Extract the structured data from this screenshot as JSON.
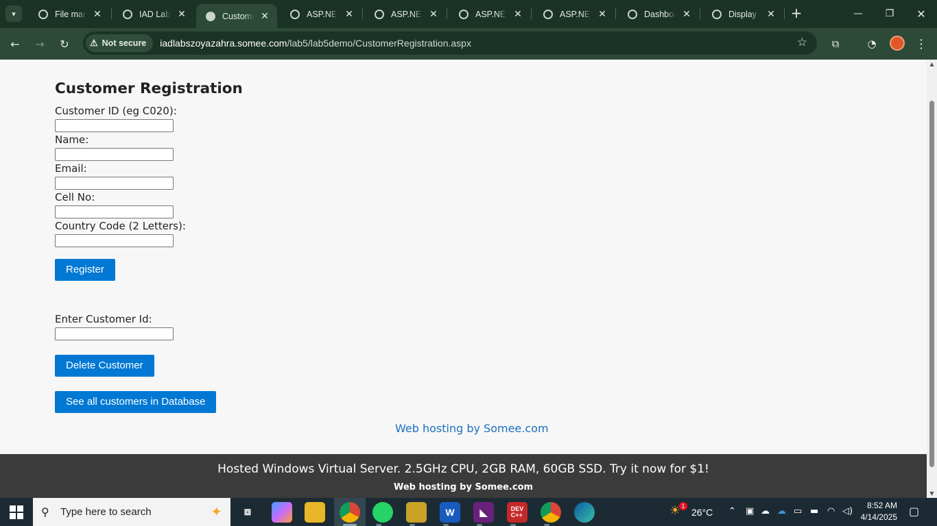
{
  "browser": {
    "tabs": [
      {
        "title": "File manager",
        "active": false
      },
      {
        "title": "IAD Lab Portal",
        "active": false
      },
      {
        "title": "Customer Registration",
        "active": true
      },
      {
        "title": "ASP.NET Page",
        "active": false
      },
      {
        "title": "ASP.NET Page",
        "active": false
      },
      {
        "title": "ASP.NET Page",
        "active": false
      },
      {
        "title": "ASP.NET Page",
        "active": false
      },
      {
        "title": "Dashboard",
        "active": false
      },
      {
        "title": "Display HTML",
        "active": false
      }
    ],
    "security_label": "Not secure",
    "url_host": "iadlabszoyazahra.somee.com",
    "url_path": "/lab5/lab5demo/CustomerRegistration.aspx"
  },
  "page": {
    "title": "Customer Registration",
    "fields": [
      {
        "label": "Customer ID (eg C020):",
        "value": ""
      },
      {
        "label": "Name:",
        "value": ""
      },
      {
        "label": "Email:",
        "value": ""
      },
      {
        "label": "Cell No:",
        "value": ""
      },
      {
        "label": "Country Code (2 Letters):",
        "value": ""
      }
    ],
    "register_label": "Register",
    "delete_field_label": "Enter Customer Id:",
    "delete_label": "Delete Customer",
    "see_all_label": "See all customers in Database",
    "hosting_link": "Web hosting by Somee.com",
    "ad_main": "Hosted Windows Virtual Server. 2.5GHz CPU, 2GB RAM, 60GB SSD. Try it now for $1!",
    "ad_sub": "Web hosting by Somee.com"
  },
  "taskbar": {
    "search_placeholder": "Type here to search",
    "weather_temp": "26°C",
    "weather_badge": "1",
    "time": "8:52 AM",
    "date": "4/14/2025",
    "apps": [
      "copilot-icon",
      "task-view-icon",
      "file-explorer-icon",
      "chrome-icon",
      "whatsapp-icon",
      "sticky-notes-icon",
      "word-icon",
      "visual-studio-icon",
      "dev-cpp-icon",
      "chrome-profile-icon",
      "edge-icon"
    ]
  },
  "colors": {
    "tab_bg": "#1b3326",
    "toolbar_bg": "#2c4a37",
    "button_blue": "#0078d4",
    "link_blue": "#1a6fbf",
    "ad_bar_bg": "#3b3b3b"
  }
}
